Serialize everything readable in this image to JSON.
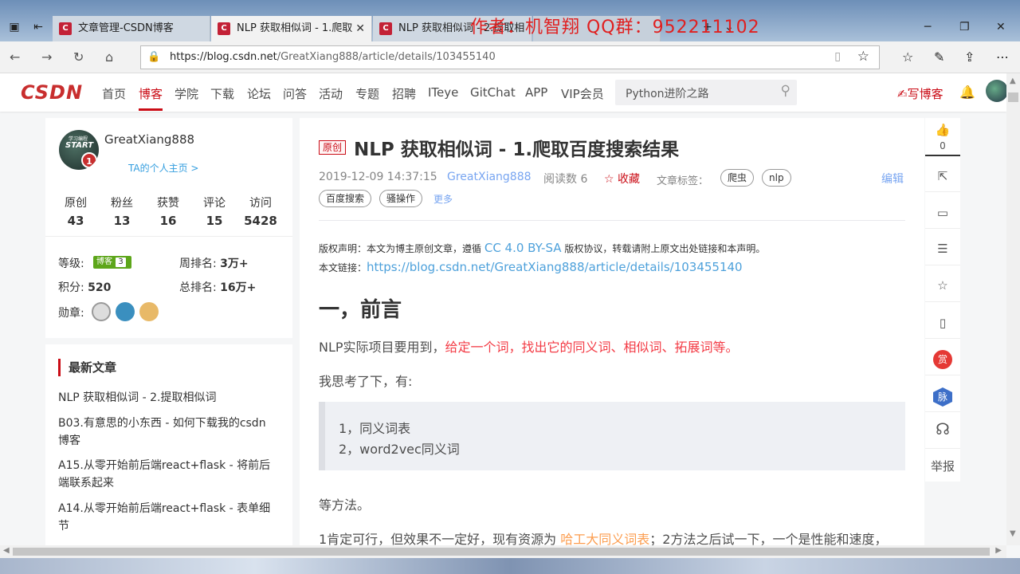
{
  "browser": {
    "tabs": [
      {
        "title": "文章管理-CSDN博客",
        "favicon": "C"
      },
      {
        "title": "NLP 获取相似词 - 1.爬取",
        "favicon": "C"
      },
      {
        "title": "NLP 获取相似词 - 2.提取相",
        "favicon": "C"
      }
    ],
    "overlay_text": "作者：机智翔  QQ群：952211102",
    "url_host": "https://blog.csdn.net",
    "url_path": "/GreatXiang888/article/details/103455140"
  },
  "csdn_nav": {
    "logo": "CSDN",
    "items": [
      "首页",
      "博客",
      "学院",
      "下载",
      "论坛",
      "问答",
      "活动",
      "专题",
      "招聘",
      "ITeye",
      "GitChat",
      "APP",
      "VIP会员"
    ],
    "active": "博客",
    "search_placeholder": "Python进阶之路",
    "write": "写博客"
  },
  "profile": {
    "avatar_text1": "学习编程",
    "avatar_text2": "START",
    "avatar_level": "1",
    "name": "GreatXiang888",
    "home_link": "TA的个人主页 >",
    "stats": [
      {
        "label": "原创",
        "value": "43"
      },
      {
        "label": "粉丝",
        "value": "13"
      },
      {
        "label": "获赞",
        "value": "16"
      },
      {
        "label": "评论",
        "value": "15"
      },
      {
        "label": "访问",
        "value": "5428"
      }
    ]
  },
  "grade": {
    "level_label": "等级:",
    "level_badge": "博客",
    "level_num": "3",
    "week_rank_label": "周排名:",
    "week_rank": "3万+",
    "points_label": "积分:",
    "points": "520",
    "total_rank_label": "总排名:",
    "total_rank": "16万+",
    "medal_label": "勋章:"
  },
  "recent": {
    "title": "最新文章",
    "items": [
      [
        "NLP 获取相似词 - 2.提取相似词"
      ],
      [
        "B03.有意思的小东西 - 如何下载我的csdn",
        "博客"
      ],
      [
        "A15.从零开始前后端react+flask - 将前后",
        "端联系起来"
      ],
      [
        "A14.从零开始前后端react+flask - 表单细",
        "节"
      ]
    ]
  },
  "article": {
    "badge": "原创",
    "title": "NLP 获取相似词 - 1.爬取百度搜索结果",
    "date": "2019-12-09 14:37:15",
    "author": "GreatXiang888",
    "reads": "阅读数 6",
    "favorite": "☆ 收藏",
    "tags_label": "文章标签：",
    "tags": [
      "爬虫",
      "nlp",
      "百度搜索",
      "骚操作"
    ],
    "more": "更多",
    "edit": "编辑",
    "copyright_prefix": "版权声明：本文为博主原创文章，遵循",
    "copyright_license": "CC 4.0 BY-SA",
    "copyright_suffix": "版权协议，转载请附上原文出处链接和本声明。",
    "link_label": "本文链接：",
    "link": "https://blog.csdn.net/GreatXiang888/article/details/103455140",
    "heading": "一，前言",
    "p1_plain": "NLP实际项目要用到，",
    "p1_red": "给定一个词，找出它的同义词、相似词、拓展词等。",
    "p2": "我思考了下，有:",
    "quote": [
      "1，同义词表",
      "2，word2vec同义词"
    ],
    "p3": "等方法。",
    "p4_a": "1肯定可行，但效果不一定好，现有资源为",
    "p4_link": "哈工大同义词表",
    "p4_b": "；2方法之后试一下，一个是性能和速度，"
  },
  "side_tools": {
    "like_count": "0",
    "reward": "赏",
    "mai": "脉",
    "report": "举报"
  }
}
